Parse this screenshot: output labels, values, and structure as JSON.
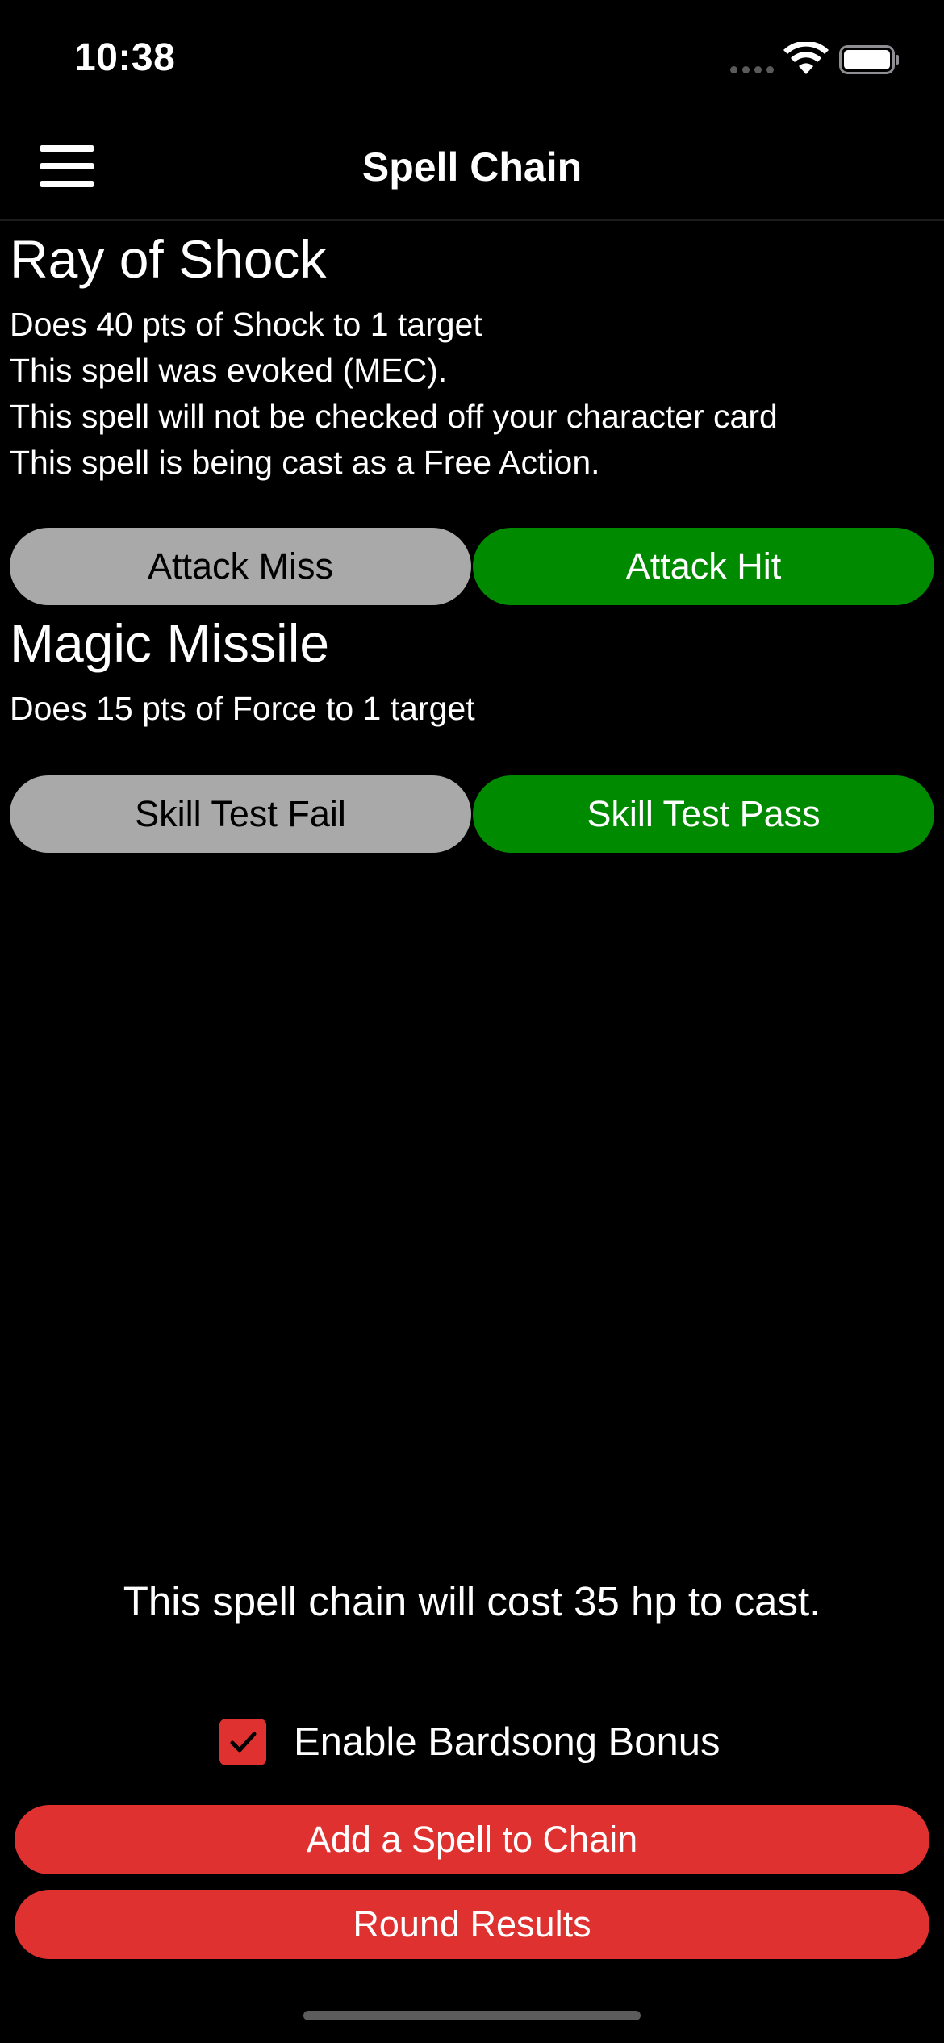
{
  "status_bar": {
    "time": "10:38",
    "icons": [
      "signal-dots-icon",
      "wifi-icon",
      "battery-icon"
    ]
  },
  "nav": {
    "menu_icon": "hamburger-menu-icon",
    "title": "Spell Chain"
  },
  "spells": [
    {
      "name": "Ray of Shock",
      "lines": [
        "Does 40 pts of Shock to 1 target",
        "This spell was evoked (MEC).",
        "This spell will not be checked off your character card",
        "This spell is being cast as a Free Action."
      ],
      "fail_label": "Attack Miss",
      "pass_label": "Attack Hit"
    },
    {
      "name": "Magic Missile",
      "lines": [
        "Does 15 pts of Force to 1 target"
      ],
      "fail_label": "Skill Test Fail",
      "pass_label": "Skill Test Pass"
    }
  ],
  "cost_text": "This spell chain will cost 35 hp to cast.",
  "bardsong": {
    "label": "Enable Bardsong Bonus",
    "checked": true
  },
  "buttons": {
    "add_spell": "Add a Spell to Chain",
    "round_results": "Round Results"
  },
  "colors": {
    "background": "#000000",
    "accent_red": "#e03131",
    "pass_green": "#008a00",
    "fail_gray": "#a9a9a9"
  }
}
